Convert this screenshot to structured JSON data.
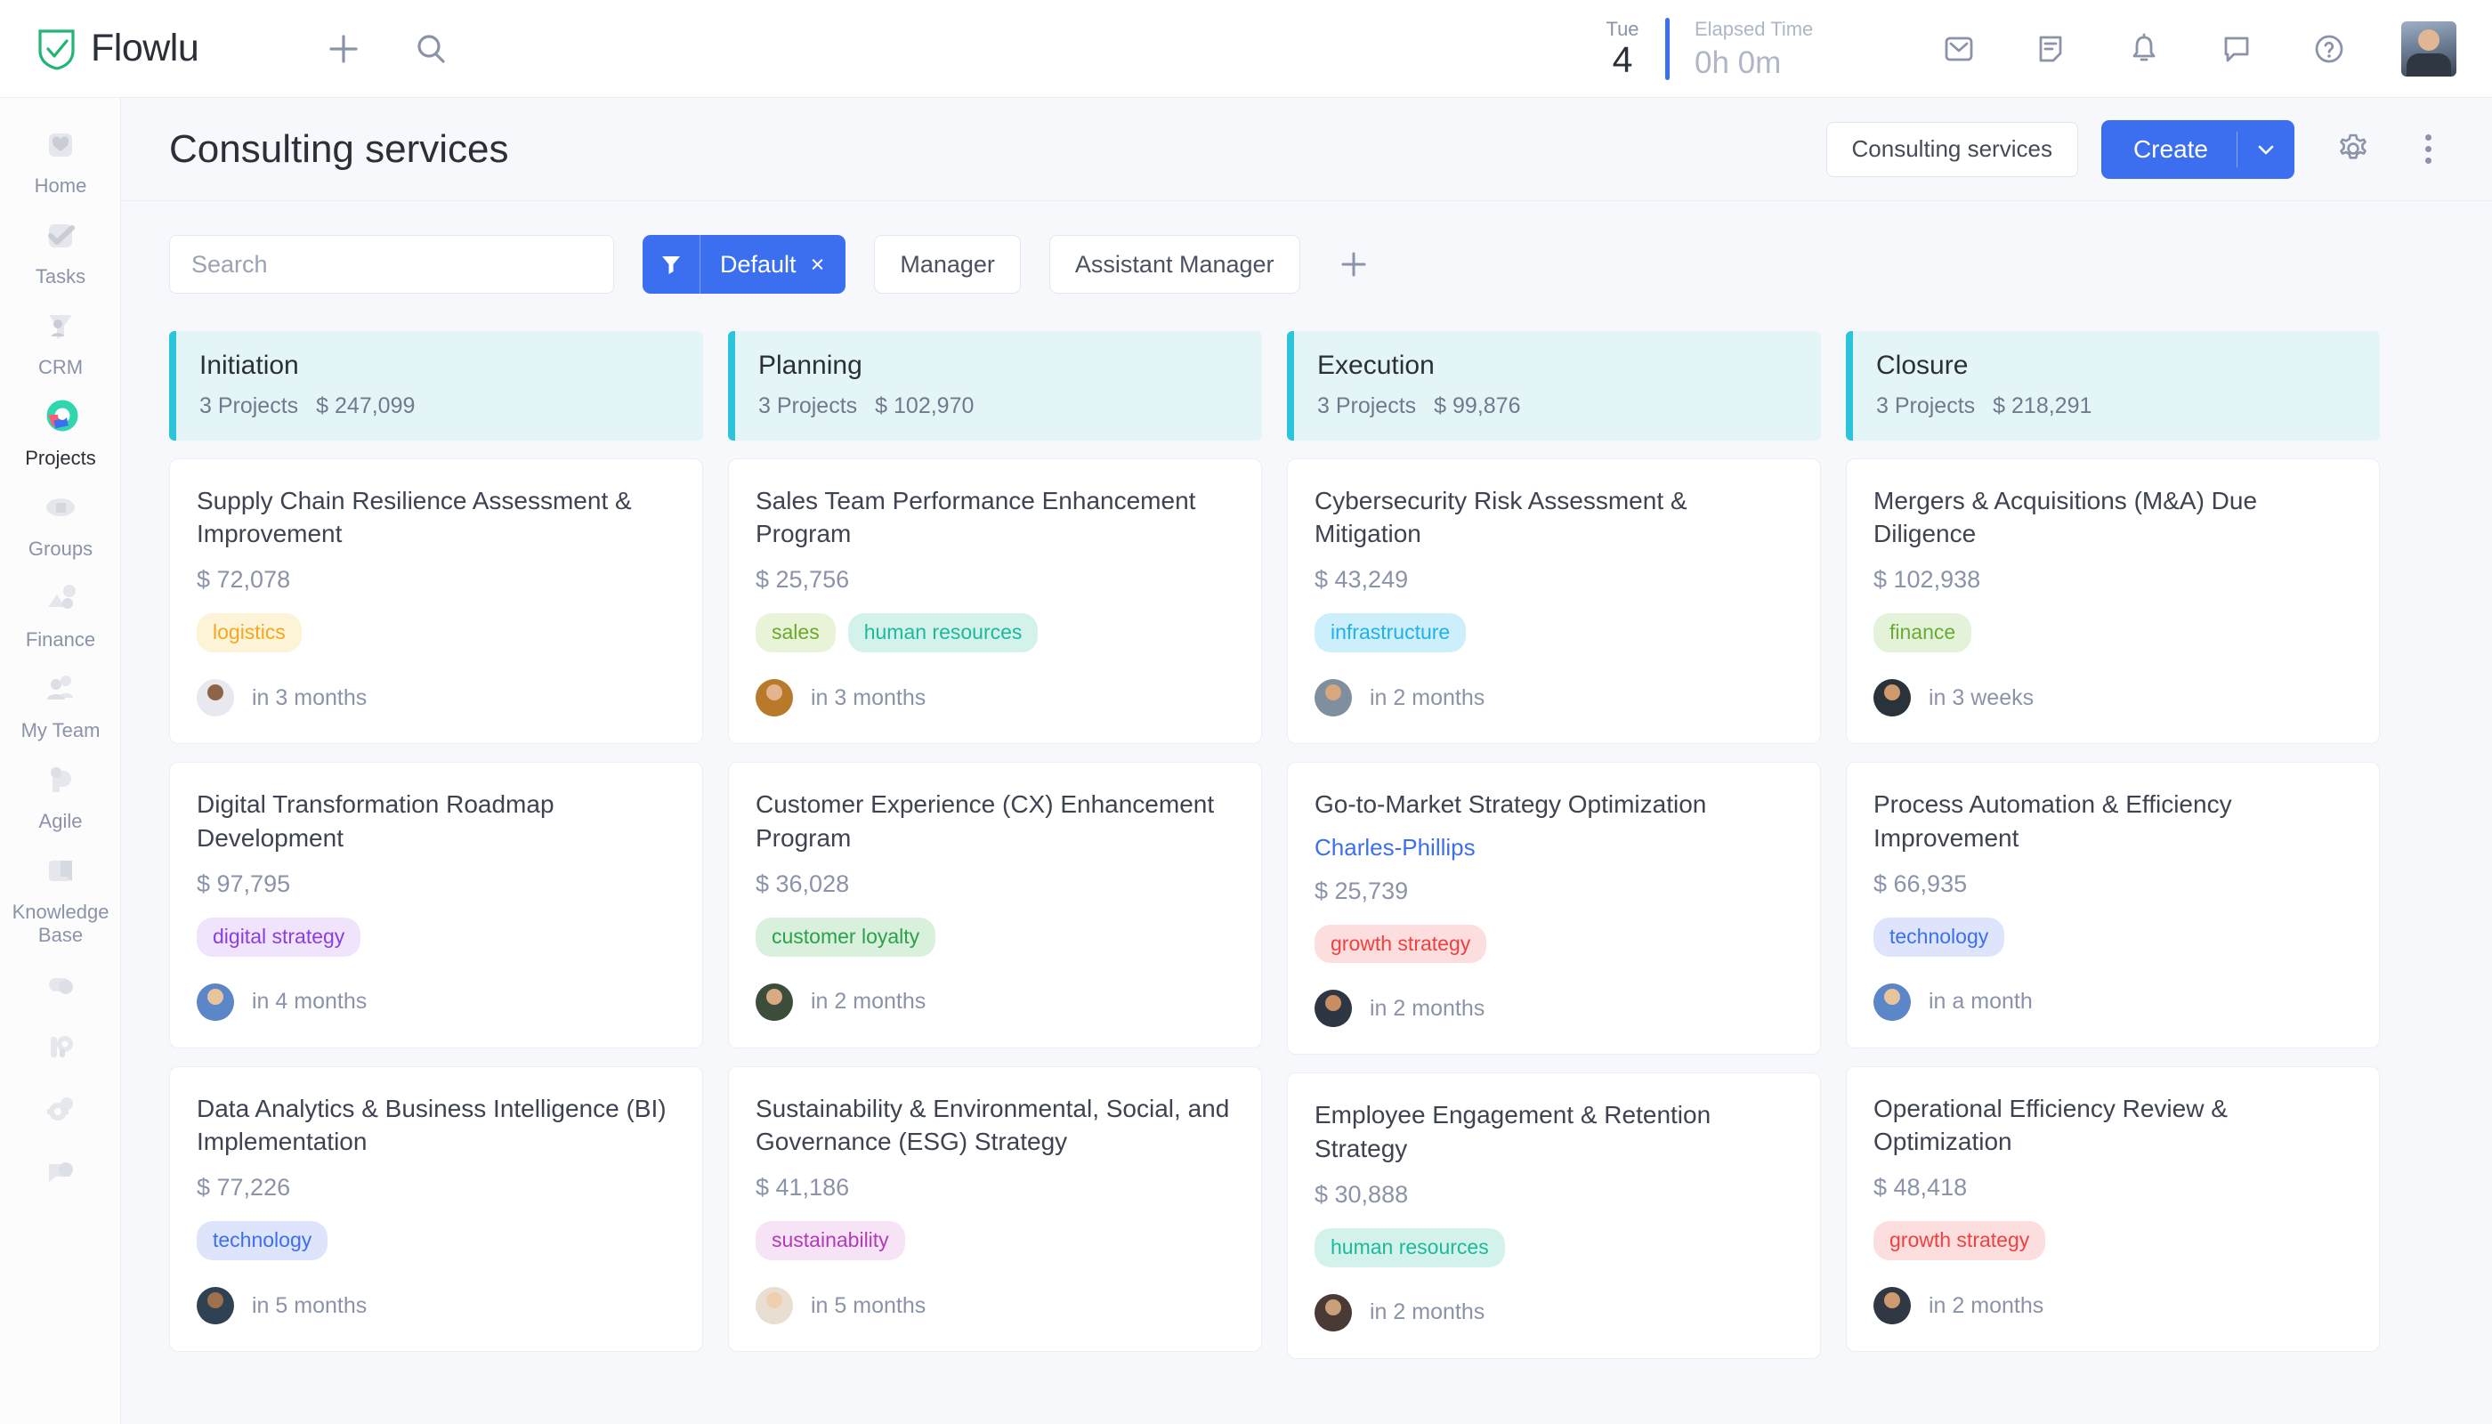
{
  "app": {
    "brand": "Flowlu",
    "brand_color": "#22b573"
  },
  "topbar": {
    "add_icon": "plus-icon",
    "search_icon": "search-icon",
    "date": {
      "weekday": "Tue",
      "day": "4"
    },
    "elapsed": {
      "label": "Elapsed Time",
      "value": "0h 0m"
    },
    "icons": [
      "mail-icon",
      "notes-icon",
      "bell-icon",
      "chat-icon",
      "help-icon"
    ],
    "avatar": "user-avatar"
  },
  "sidebar": {
    "items": [
      {
        "label": "Home",
        "icon": "home-icon",
        "active": false
      },
      {
        "label": "Tasks",
        "icon": "tasks-icon",
        "active": false
      },
      {
        "label": "CRM",
        "icon": "crm-icon",
        "active": false
      },
      {
        "label": "Projects",
        "icon": "projects-icon",
        "active": true
      },
      {
        "label": "Groups",
        "icon": "groups-icon",
        "active": false
      },
      {
        "label": "Finance",
        "icon": "finance-icon",
        "active": false
      },
      {
        "label": "My Team",
        "icon": "my-team-icon",
        "active": false
      },
      {
        "label": "Agile",
        "icon": "agile-icon",
        "active": false
      },
      {
        "label": "Knowledge Base",
        "icon": "knowledge-base-icon",
        "active": false
      },
      {
        "label": "",
        "icon": "toggle-icon",
        "active": false
      },
      {
        "label": "",
        "icon": "portal-icon",
        "active": false
      },
      {
        "label": "",
        "icon": "settings-gear-icon",
        "active": false
      },
      {
        "label": "",
        "icon": "feedback-icon",
        "active": false
      }
    ]
  },
  "header": {
    "title": "Consulting services",
    "view_button": "Consulting services",
    "create_button": "Create",
    "create_caret": "chevron-down-icon",
    "settings_icon": "gear-icon",
    "more_icon": "kebab-menu-icon"
  },
  "filters": {
    "search_placeholder": "Search",
    "search_value": "",
    "search_icon": "search-icon",
    "active_filter": {
      "label": "Default",
      "icon": "funnel-icon",
      "remove": "×"
    },
    "tabs": [
      "Manager",
      "Assistant Manager"
    ],
    "add_icon": "plus-icon"
  },
  "board": {
    "columns": [
      {
        "title": "Initiation",
        "count": "3 Projects",
        "amount": "$ 247,099",
        "cards": [
          {
            "title": "Supply Chain Resilience Assessment & Improvement",
            "client": "",
            "amount": "$ 72,078",
            "tags": [
              {
                "label": "logistics",
                "bg": "#fdf3d6",
                "fg": "#f5a623"
              }
            ],
            "due": "in 3 months",
            "avatar_skin": "#8d6448",
            "avatar_body": "#e8e9ee"
          },
          {
            "title": "Digital Transformation Roadmap Development",
            "client": "",
            "amount": "$ 97,795",
            "tags": [
              {
                "label": "digital strategy",
                "bg": "#efe4fb",
                "fg": "#8b3ee0"
              }
            ],
            "due": "in 4 months",
            "avatar_skin": "#e8c49c",
            "avatar_body": "#5b87c9"
          },
          {
            "title": "Data Analytics & Business Intelligence (BI) Implementation",
            "client": "",
            "amount": "$ 77,226",
            "tags": [
              {
                "label": "technology",
                "bg": "#dde4fb",
                "fg": "#3c6ff0"
              }
            ],
            "due": "in 5 months",
            "avatar_skin": "#a06f4c",
            "avatar_body": "#2f4254"
          }
        ]
      },
      {
        "title": "Planning",
        "count": "3 Projects",
        "amount": "$ 102,970",
        "cards": [
          {
            "title": "Sales Team Performance Enhancement Program",
            "client": "",
            "amount": "$ 25,756",
            "tags": [
              {
                "label": "sales",
                "bg": "#e8f3d8",
                "fg": "#6aa82e"
              },
              {
                "label": "human resources",
                "bg": "#d4f2ec",
                "fg": "#1db99a"
              }
            ],
            "due": "in 3 months",
            "avatar_skin": "#e3b48e",
            "avatar_body": "#b9792a"
          },
          {
            "title": "Customer Experience (CX) Enhancement Program",
            "client": "",
            "amount": "$ 36,028",
            "tags": [
              {
                "label": "customer loyalty",
                "bg": "#d9f0dc",
                "fg": "#2aa14a"
              }
            ],
            "due": "in 2 months",
            "avatar_skin": "#d9ab83",
            "avatar_body": "#3d4d3c"
          },
          {
            "title": "Sustainability & Environmental, Social, and Governance (ESG) Strategy",
            "client": "",
            "amount": "$ 41,186",
            "tags": [
              {
                "label": "sustainability",
                "bg": "#f7e3f6",
                "fg": "#b13bb8"
              }
            ],
            "due": "in 5 months",
            "avatar_skin": "#f0cfae",
            "avatar_body": "#e8dfd2"
          }
        ]
      },
      {
        "title": "Execution",
        "count": "3 Projects",
        "amount": "$ 99,876",
        "cards": [
          {
            "title": "Cybersecurity Risk Assessment & Mitigation",
            "client": "",
            "amount": "$ 43,249",
            "tags": [
              {
                "label": "infrastructure",
                "bg": "#cdeefb",
                "fg": "#21b1ea"
              }
            ],
            "due": "in 2 months",
            "avatar_skin": "#d9a77d",
            "avatar_body": "#7f8fa0"
          },
          {
            "title": "Go-to-Market Strategy Optimization",
            "client": "Charles-Phillips",
            "amount": "$ 25,739",
            "tags": [
              {
                "label": "growth strategy",
                "bg": "#fcdede",
                "fg": "#f0413f"
              }
            ],
            "due": "in 2 months",
            "avatar_skin": "#c98d63",
            "avatar_body": "#2d3642"
          },
          {
            "title": "Employee Engagement & Retention Strategy",
            "client": "",
            "amount": "$ 30,888",
            "tags": [
              {
                "label": "human resources",
                "bg": "#d4f2ec",
                "fg": "#1db99a"
              }
            ],
            "due": "in 2 months",
            "avatar_skin": "#caa07c",
            "avatar_body": "#4a3a35"
          }
        ]
      },
      {
        "title": "Closure",
        "count": "3 Projects",
        "amount": "$ 218,291",
        "cards": [
          {
            "title": "Mergers & Acquisitions (M&A) Due Diligence",
            "client": "",
            "amount": "$ 102,938",
            "tags": [
              {
                "label": "finance",
                "bg": "#e3f2d9",
                "fg": "#69ab35"
              }
            ],
            "due": "in 3 weeks",
            "avatar_skin": "#cf9a6d",
            "avatar_body": "#2a323c"
          },
          {
            "title": "Process Automation & Efficiency Improvement",
            "client": "",
            "amount": "$ 66,935",
            "tags": [
              {
                "label": "technology",
                "bg": "#dde4fb",
                "fg": "#3c6ff0"
              }
            ],
            "due": "in a month",
            "avatar_skin": "#e8c49c",
            "avatar_body": "#5b87c9"
          },
          {
            "title": "Operational Efficiency Review & Optimization",
            "client": "",
            "amount": "$ 48,418",
            "tags": [
              {
                "label": "growth strategy",
                "bg": "#fcdede",
                "fg": "#f0413f"
              }
            ],
            "due": "in 2 months",
            "avatar_skin": "#cf9a6d",
            "avatar_body": "#303844"
          }
        ]
      }
    ]
  }
}
